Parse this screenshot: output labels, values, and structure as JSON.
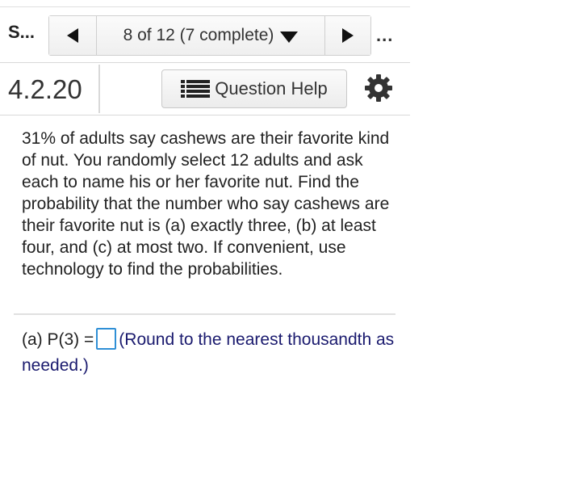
{
  "header": {
    "section_label": "S...",
    "progress": "8 of 12 (7 complete)",
    "more": "..."
  },
  "question_row": {
    "number": "4.2.20",
    "help_label": "Question Help"
  },
  "question": {
    "text": "31% of adults say cashews are their favorite kind of nut. You randomly select 12 adults and ask each to name his or her favorite nut. Find the probability that the number who say cashews are their favorite nut is (a) exactly three, (b) at least four, and (c) at most two. If convenient, use technology to find the probabilities."
  },
  "answer": {
    "prefix": "(a) P(3) =",
    "hint": "(Round to the nearest thousandth as needed.)",
    "value": ""
  },
  "icons": {
    "prev": "triangle-left-icon",
    "next": "triangle-right-icon",
    "dropdown": "triangle-down-icon",
    "help": "list-icon",
    "settings": "gear-icon"
  },
  "colors": {
    "input_border": "#2f8fd6",
    "hint_text": "#1a1a6e"
  }
}
